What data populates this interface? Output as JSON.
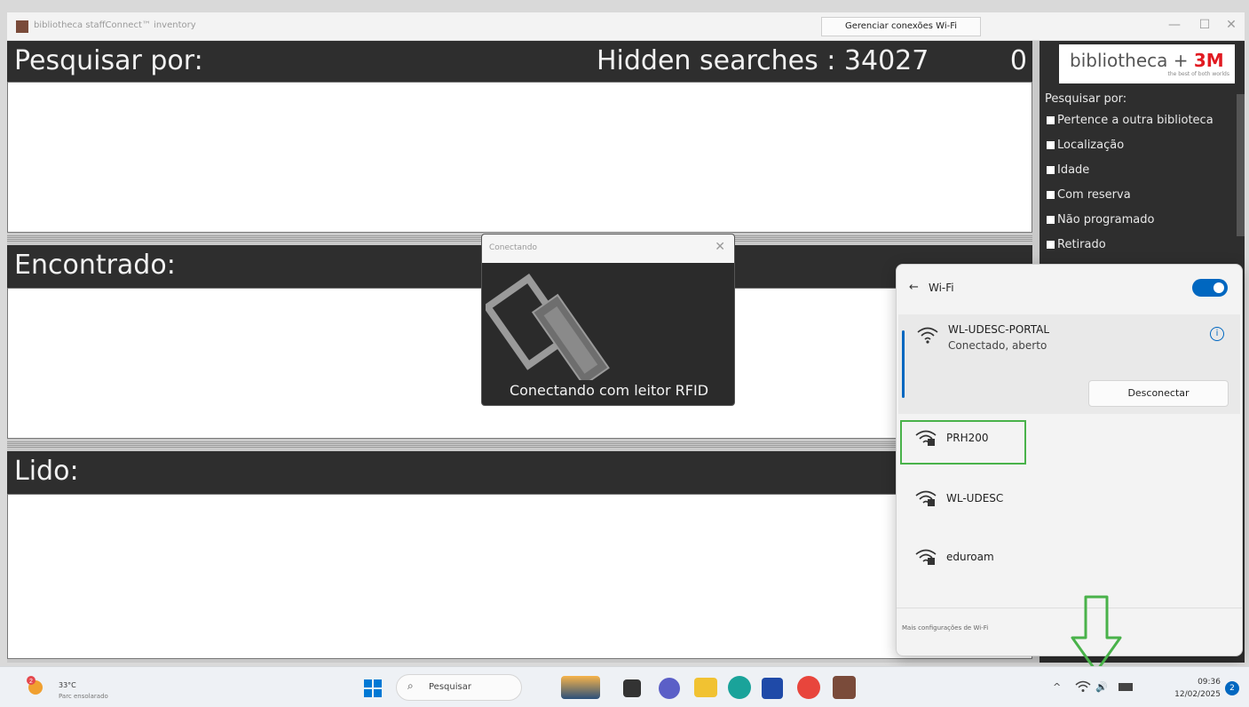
{
  "window": {
    "title": "bibliotheca staffConnect™ inventory",
    "tooltip": "Gerenciar conexões Wi-Fi",
    "minimize": "—",
    "maximize": "☐",
    "close": "✕"
  },
  "sections": {
    "search_label": "Pesquisar por:",
    "hidden_searches": "Hidden searches : 34027",
    "search_count": "0",
    "found_label": "Encontrado:",
    "read_label": "Lido:"
  },
  "right_panel": {
    "logo_text": "bibliotheca",
    "logo_plus": " + ",
    "logo_brand": "3M",
    "logo_tagline": "the best of both worlds",
    "filter_title": "Pesquisar por:",
    "filters": [
      "Pertence a outra biblioteca",
      "Localização",
      "Idade",
      "Com reserva",
      "Não programado",
      "Retirado"
    ]
  },
  "dialog": {
    "title": "Conectando",
    "close": "✕",
    "message": "Conectando com leitor RFID"
  },
  "wifi": {
    "back": "←",
    "title": "Wi-Fi",
    "connected": {
      "name": "WL-UDESC-PORTAL",
      "status": "Conectado, aberto",
      "info": "i",
      "disconnect_label": "Desconectar"
    },
    "networks": [
      "PRH200",
      "WL-UDESC",
      "eduroam"
    ],
    "footer": "Mais configurações de Wi-Fi"
  },
  "taskbar": {
    "weather_temp": "33°C",
    "weather_badge": "2",
    "weather_desc": "Parc ensolarado",
    "search_placeholder": "Pesquisar",
    "tray_chevron": "^",
    "tray_volume": "🔊",
    "time": "09:36",
    "date": "12/02/2025",
    "notif": "2"
  },
  "colors": {
    "accent": "#0067c0",
    "highlight": "#49b24a",
    "panel_dark": "#2e2e2e"
  }
}
